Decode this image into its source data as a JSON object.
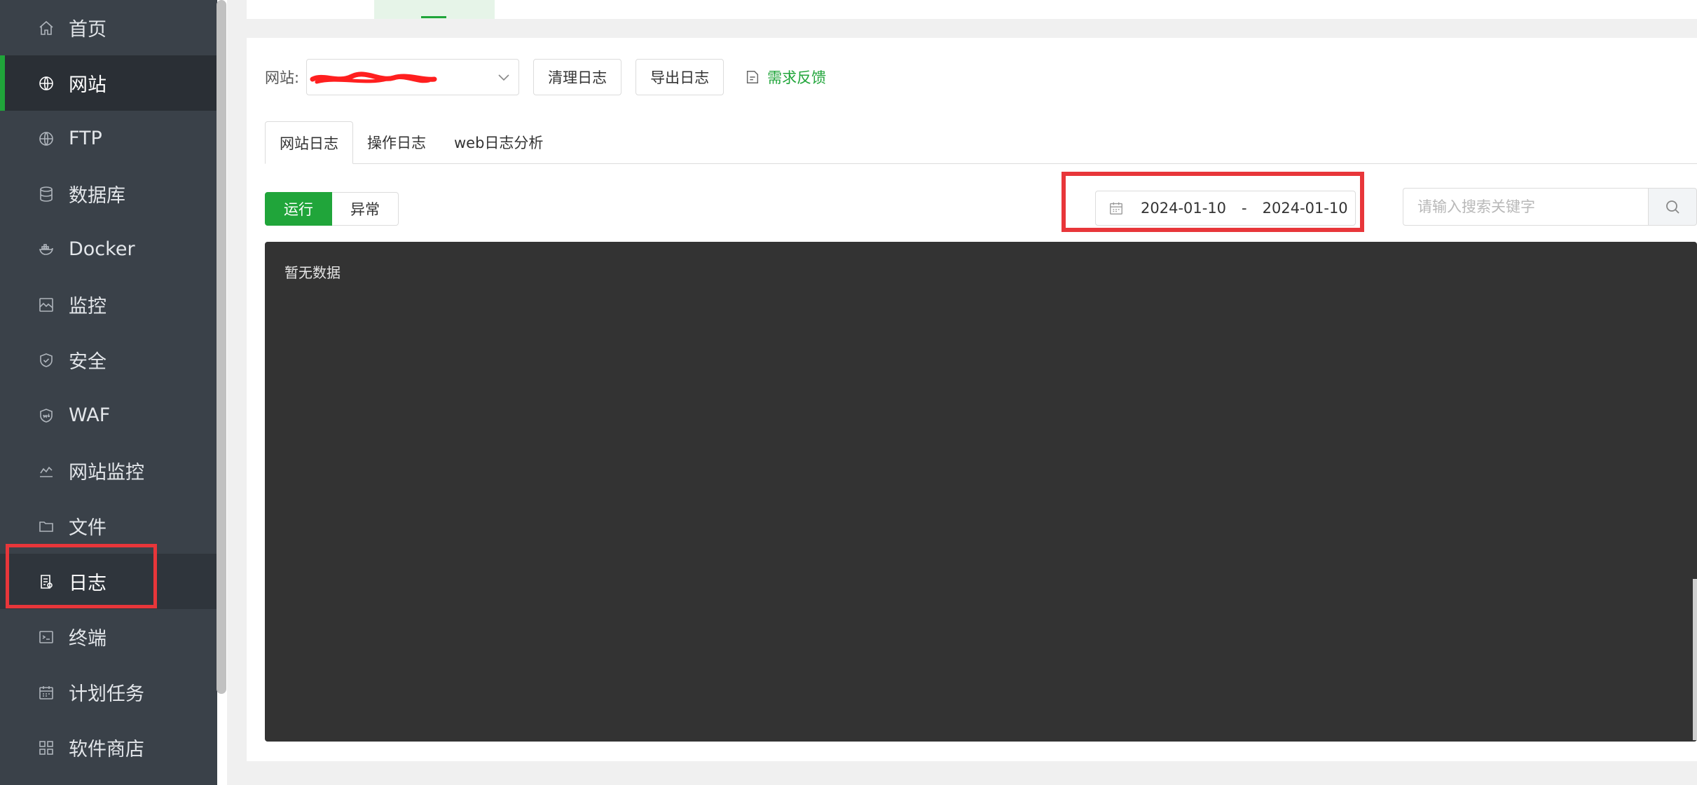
{
  "sidebar": {
    "items": [
      {
        "label": "首页",
        "icon": "home-icon"
      },
      {
        "label": "网站",
        "icon": "globe-icon",
        "state": "active"
      },
      {
        "label": "FTP",
        "icon": "ftp-globe-icon"
      },
      {
        "label": "数据库",
        "icon": "database-icon"
      },
      {
        "label": "Docker",
        "icon": "docker-icon"
      },
      {
        "label": "监控",
        "icon": "monitor-icon"
      },
      {
        "label": "安全",
        "icon": "shield-icon"
      },
      {
        "label": "WAF",
        "icon": "waf-shield-icon"
      },
      {
        "label": "网站监控",
        "icon": "line-chart-icon"
      },
      {
        "label": "文件",
        "icon": "folder-icon"
      },
      {
        "label": "日志",
        "icon": "log-document-icon",
        "state": "selected"
      },
      {
        "label": "终端",
        "icon": "terminal-icon"
      },
      {
        "label": "计划任务",
        "icon": "calendar-task-icon"
      },
      {
        "label": "软件商店",
        "icon": "app-grid-icon"
      }
    ]
  },
  "toolbar": {
    "site_label": "网站:",
    "clear_log": "清理日志",
    "export_log": "导出日志",
    "feedback": "需求反馈"
  },
  "tabs": [
    "网站日志",
    "操作日志",
    "web日志分析"
  ],
  "filter": {
    "run": "运行",
    "error": "异常"
  },
  "date_range": {
    "start": "2024-01-10",
    "separator": "-",
    "end": "2024-01-10"
  },
  "search": {
    "placeholder": "请输入搜索关键字"
  },
  "log": {
    "empty_text": "暂无数据"
  },
  "colors": {
    "accent": "#20a53a",
    "sidebar_bg": "#3a4149",
    "highlight_red": "#e8363a",
    "log_bg": "#333333"
  }
}
